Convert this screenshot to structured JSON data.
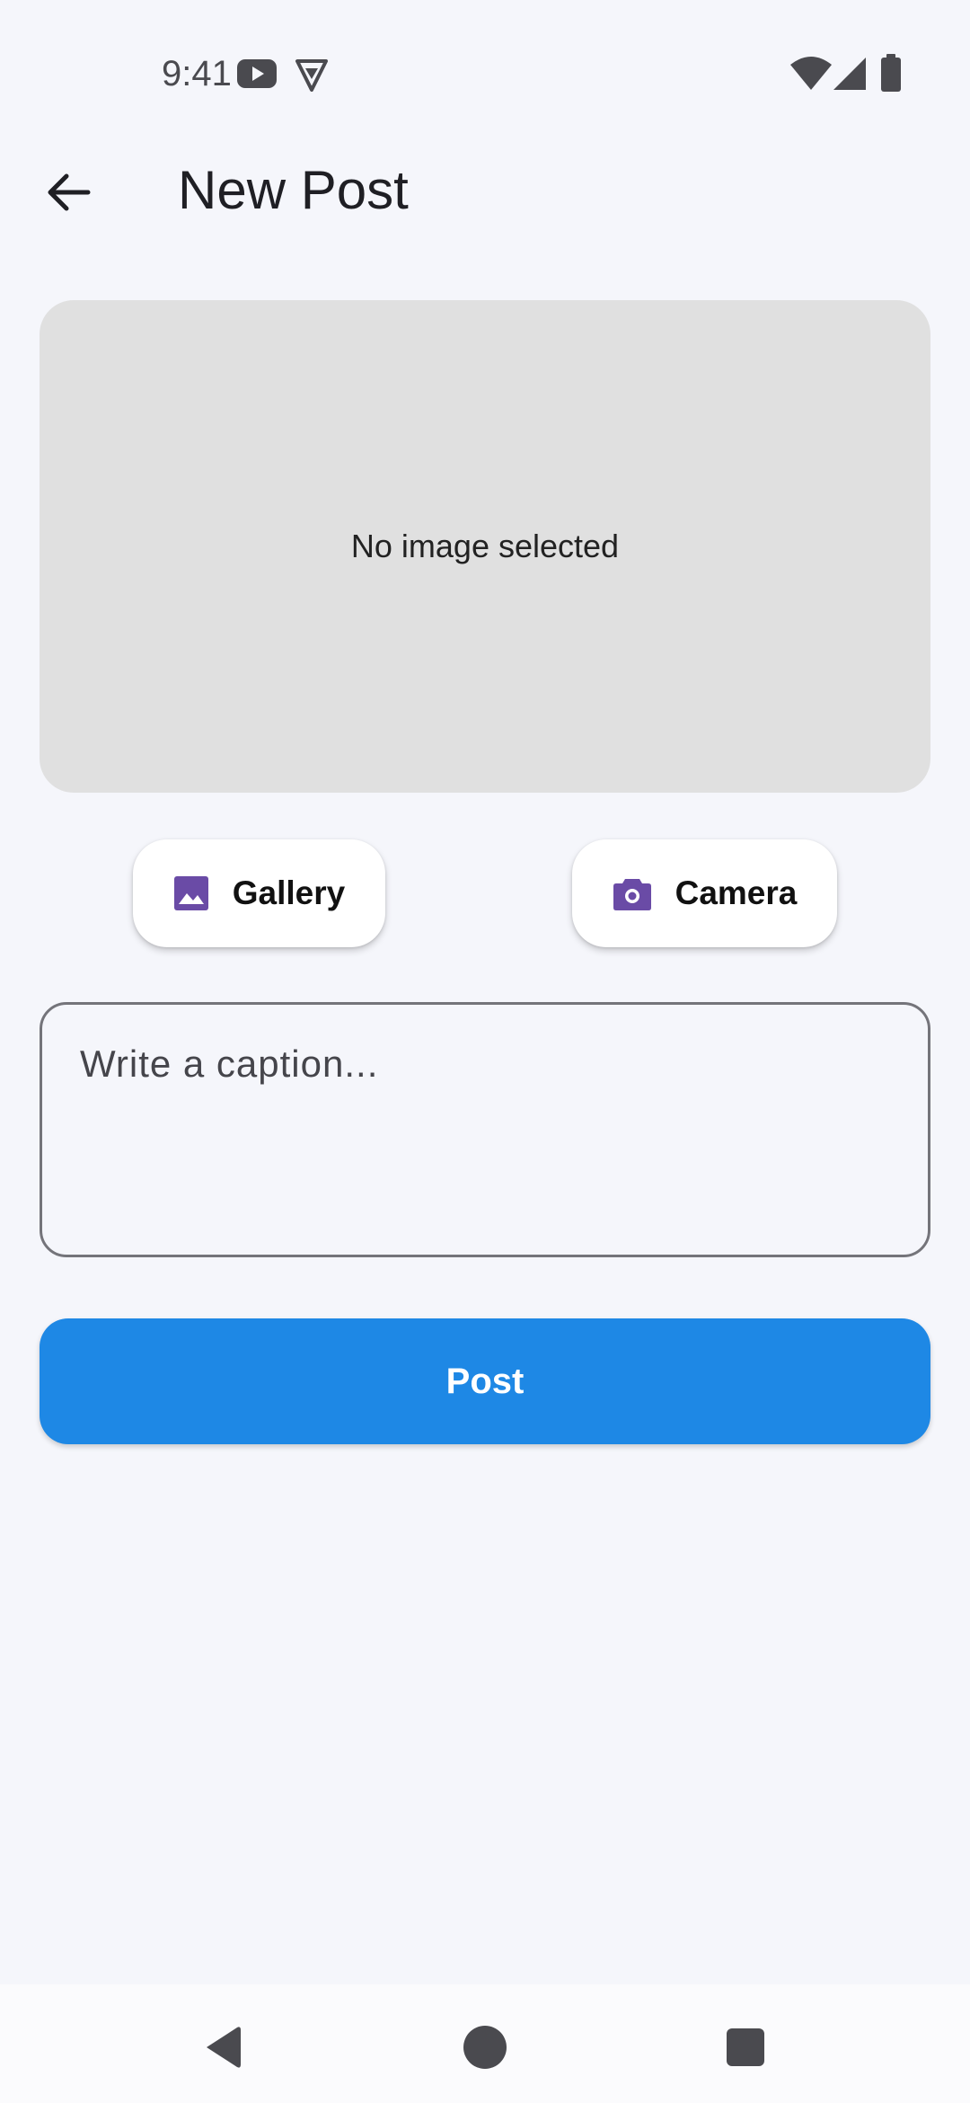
{
  "status_bar": {
    "time": "9:41",
    "left_icons": [
      "youtube-icon",
      "shield-badge-icon"
    ],
    "right_icons": [
      "wifi-icon",
      "cellular-signal-icon",
      "battery-icon"
    ]
  },
  "app_bar": {
    "back_icon": "arrow-back-icon",
    "title": "New Post"
  },
  "image_preview": {
    "empty_text": "No image selected",
    "background_color": "#e0e0e0"
  },
  "source_buttons": {
    "gallery": {
      "label": "Gallery",
      "icon": "image-icon"
    },
    "camera": {
      "label": "Camera",
      "icon": "camera-icon"
    },
    "icon_color": "#6a4ba6"
  },
  "caption": {
    "value": "",
    "placeholder": "Write a caption..."
  },
  "post_button": {
    "label": "Post",
    "color": "#1e88e5"
  },
  "nav_bar": {
    "buttons": [
      "back-triangle-icon",
      "home-circle-icon",
      "recents-square-icon"
    ]
  }
}
